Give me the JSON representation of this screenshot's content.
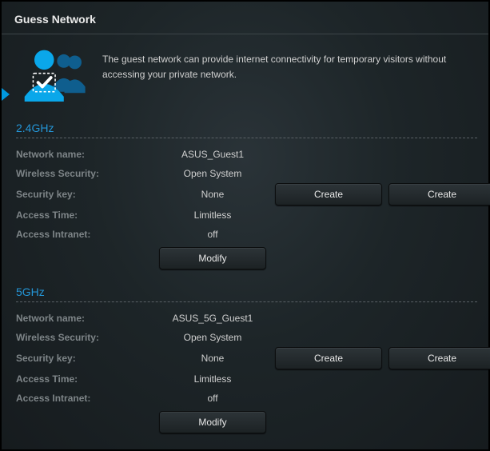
{
  "page": {
    "title": "Guess Network",
    "intro": "The guest network can provide internet connectivity for temporary visitors without accessing your private network."
  },
  "labels": {
    "network_name": "Network name:",
    "wireless_security": "Wireless Security:",
    "security_key": "Security key:",
    "access_time": "Access Time:",
    "access_intranet": "Access Intranet:"
  },
  "buttons": {
    "create": "Create",
    "modify": "Modify"
  },
  "bands": {
    "g24": {
      "title": "2.4GHz",
      "network_name": "ASUS_Guest1",
      "wireless_security": "Open System",
      "security_key": "None",
      "access_time": "Limitless",
      "access_intranet": "off"
    },
    "g5": {
      "title": "5GHz",
      "network_name": "ASUS_5G_Guest1",
      "wireless_security": "Open System",
      "security_key": "None",
      "access_time": "Limitless",
      "access_intranet": "off"
    }
  }
}
